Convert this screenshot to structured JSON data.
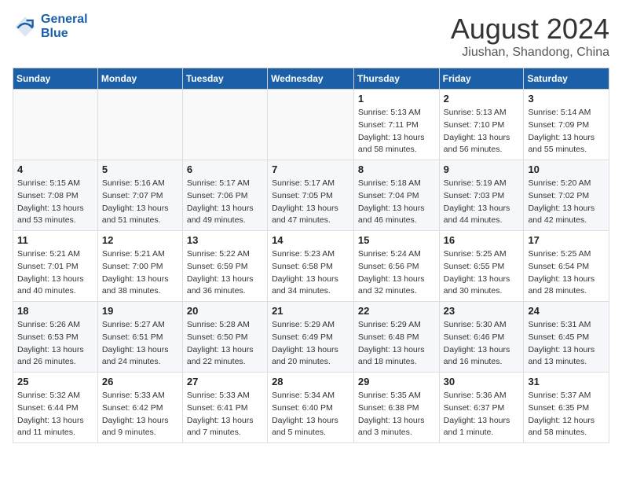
{
  "header": {
    "logo_line1": "General",
    "logo_line2": "Blue",
    "month_year": "August 2024",
    "location": "Jiushan, Shandong, China"
  },
  "days_of_week": [
    "Sunday",
    "Monday",
    "Tuesday",
    "Wednesday",
    "Thursday",
    "Friday",
    "Saturday"
  ],
  "weeks": [
    [
      {
        "day": "",
        "info": ""
      },
      {
        "day": "",
        "info": ""
      },
      {
        "day": "",
        "info": ""
      },
      {
        "day": "",
        "info": ""
      },
      {
        "day": "1",
        "info": "Sunrise: 5:13 AM\nSunset: 7:11 PM\nDaylight: 13 hours\nand 58 minutes."
      },
      {
        "day": "2",
        "info": "Sunrise: 5:13 AM\nSunset: 7:10 PM\nDaylight: 13 hours\nand 56 minutes."
      },
      {
        "day": "3",
        "info": "Sunrise: 5:14 AM\nSunset: 7:09 PM\nDaylight: 13 hours\nand 55 minutes."
      }
    ],
    [
      {
        "day": "4",
        "info": "Sunrise: 5:15 AM\nSunset: 7:08 PM\nDaylight: 13 hours\nand 53 minutes."
      },
      {
        "day": "5",
        "info": "Sunrise: 5:16 AM\nSunset: 7:07 PM\nDaylight: 13 hours\nand 51 minutes."
      },
      {
        "day": "6",
        "info": "Sunrise: 5:17 AM\nSunset: 7:06 PM\nDaylight: 13 hours\nand 49 minutes."
      },
      {
        "day": "7",
        "info": "Sunrise: 5:17 AM\nSunset: 7:05 PM\nDaylight: 13 hours\nand 47 minutes."
      },
      {
        "day": "8",
        "info": "Sunrise: 5:18 AM\nSunset: 7:04 PM\nDaylight: 13 hours\nand 46 minutes."
      },
      {
        "day": "9",
        "info": "Sunrise: 5:19 AM\nSunset: 7:03 PM\nDaylight: 13 hours\nand 44 minutes."
      },
      {
        "day": "10",
        "info": "Sunrise: 5:20 AM\nSunset: 7:02 PM\nDaylight: 13 hours\nand 42 minutes."
      }
    ],
    [
      {
        "day": "11",
        "info": "Sunrise: 5:21 AM\nSunset: 7:01 PM\nDaylight: 13 hours\nand 40 minutes."
      },
      {
        "day": "12",
        "info": "Sunrise: 5:21 AM\nSunset: 7:00 PM\nDaylight: 13 hours\nand 38 minutes."
      },
      {
        "day": "13",
        "info": "Sunrise: 5:22 AM\nSunset: 6:59 PM\nDaylight: 13 hours\nand 36 minutes."
      },
      {
        "day": "14",
        "info": "Sunrise: 5:23 AM\nSunset: 6:58 PM\nDaylight: 13 hours\nand 34 minutes."
      },
      {
        "day": "15",
        "info": "Sunrise: 5:24 AM\nSunset: 6:56 PM\nDaylight: 13 hours\nand 32 minutes."
      },
      {
        "day": "16",
        "info": "Sunrise: 5:25 AM\nSunset: 6:55 PM\nDaylight: 13 hours\nand 30 minutes."
      },
      {
        "day": "17",
        "info": "Sunrise: 5:25 AM\nSunset: 6:54 PM\nDaylight: 13 hours\nand 28 minutes."
      }
    ],
    [
      {
        "day": "18",
        "info": "Sunrise: 5:26 AM\nSunset: 6:53 PM\nDaylight: 13 hours\nand 26 minutes."
      },
      {
        "day": "19",
        "info": "Sunrise: 5:27 AM\nSunset: 6:51 PM\nDaylight: 13 hours\nand 24 minutes."
      },
      {
        "day": "20",
        "info": "Sunrise: 5:28 AM\nSunset: 6:50 PM\nDaylight: 13 hours\nand 22 minutes."
      },
      {
        "day": "21",
        "info": "Sunrise: 5:29 AM\nSunset: 6:49 PM\nDaylight: 13 hours\nand 20 minutes."
      },
      {
        "day": "22",
        "info": "Sunrise: 5:29 AM\nSunset: 6:48 PM\nDaylight: 13 hours\nand 18 minutes."
      },
      {
        "day": "23",
        "info": "Sunrise: 5:30 AM\nSunset: 6:46 PM\nDaylight: 13 hours\nand 16 minutes."
      },
      {
        "day": "24",
        "info": "Sunrise: 5:31 AM\nSunset: 6:45 PM\nDaylight: 13 hours\nand 13 minutes."
      }
    ],
    [
      {
        "day": "25",
        "info": "Sunrise: 5:32 AM\nSunset: 6:44 PM\nDaylight: 13 hours\nand 11 minutes."
      },
      {
        "day": "26",
        "info": "Sunrise: 5:33 AM\nSunset: 6:42 PM\nDaylight: 13 hours\nand 9 minutes."
      },
      {
        "day": "27",
        "info": "Sunrise: 5:33 AM\nSunset: 6:41 PM\nDaylight: 13 hours\nand 7 minutes."
      },
      {
        "day": "28",
        "info": "Sunrise: 5:34 AM\nSunset: 6:40 PM\nDaylight: 13 hours\nand 5 minutes."
      },
      {
        "day": "29",
        "info": "Sunrise: 5:35 AM\nSunset: 6:38 PM\nDaylight: 13 hours\nand 3 minutes."
      },
      {
        "day": "30",
        "info": "Sunrise: 5:36 AM\nSunset: 6:37 PM\nDaylight: 13 hours\nand 1 minute."
      },
      {
        "day": "31",
        "info": "Sunrise: 5:37 AM\nSunset: 6:35 PM\nDaylight: 12 hours\nand 58 minutes."
      }
    ]
  ]
}
